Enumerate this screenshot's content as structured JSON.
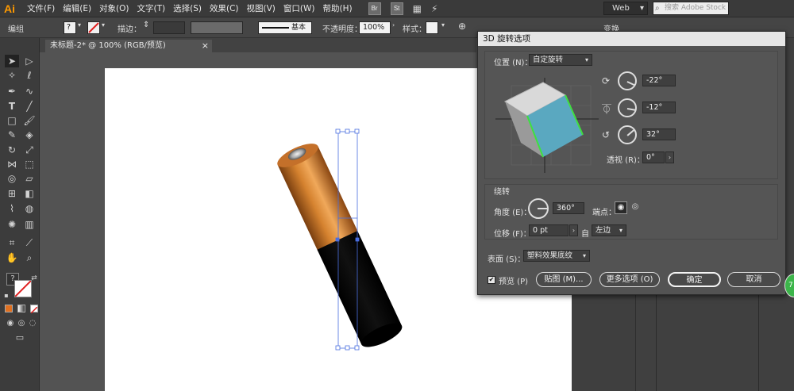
{
  "app": {
    "logo": "Ai"
  },
  "menu": [
    "文件(F)",
    "编辑(E)",
    "对象(O)",
    "文字(T)",
    "选择(S)",
    "效果(C)",
    "视图(V)",
    "窗口(W)",
    "帮助(H)"
  ],
  "menubar_apps": {
    "bridge": "Br",
    "stock": "St"
  },
  "workspace": {
    "label": "Web",
    "arrow": "▾"
  },
  "search": {
    "placeholder": "搜索 Adobe Stock"
  },
  "controlbar": {
    "mode": "编组",
    "stroke_label": "描边：",
    "stroke_style": "基本",
    "opacity_label": "不透明度：",
    "opacity_value": "100%",
    "style_label": "样式：",
    "right_label": "变换"
  },
  "document_tab": {
    "title": "未标题-2* @ 100% (RGB/预览)",
    "close": "×"
  },
  "dialog": {
    "title": "3D 旋转选项",
    "position_label": "位置 (N)：",
    "position_value": "自定旋转",
    "rot_x": "-22°",
    "rot_y": "-12°",
    "rot_z": "32°",
    "perspective_label": "透视 (R)：",
    "perspective_value": "0°",
    "revolve_title": "绕转",
    "angle_label": "角度 (E)：",
    "angle_value": "360°",
    "cap_label": "端点：",
    "offset_label": "位移 (F)：",
    "offset_value": "0 pt",
    "from_label": "自",
    "from_value": "左边",
    "surface_label": "表面 (S)：",
    "surface_value": "塑料效果底纹",
    "preview_label": "预览 (P)",
    "preview_checked": "✔",
    "map_button": "贴图 (M)...",
    "more_button": "更多选项 (O)",
    "ok_button": "确定",
    "cancel_button": "取消"
  },
  "colors": {
    "accent": "#ff9a00",
    "cube_face": "#5aa8c0",
    "battery_cap": "#c8742a",
    "edge_highlight": "#3fe03f"
  }
}
